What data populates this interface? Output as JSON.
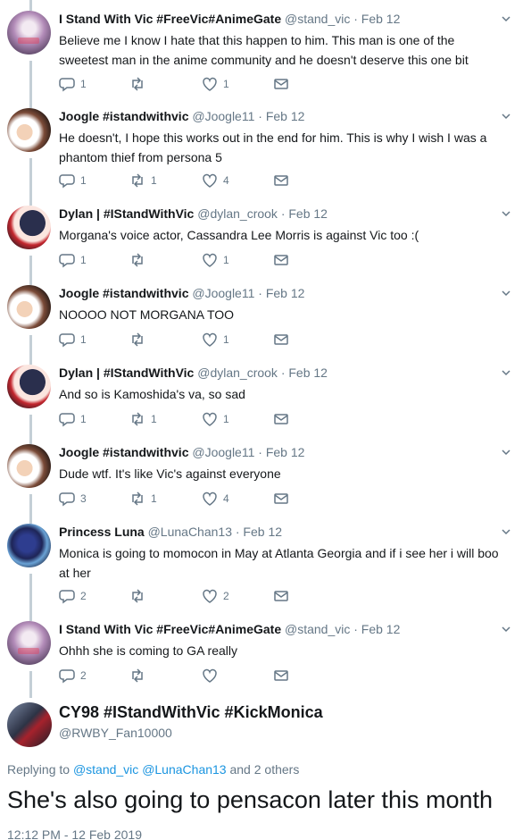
{
  "replies": [
    {
      "avatar": "ivic",
      "name": "I Stand With Vic #FreeVic#AnimeGate",
      "handle_meta": "@stand_vic · Feb 12",
      "text": "Believe me I know I hate that this happen to him. This man is one of the sweetest man in the anime community and he doesn't deserve this one bit",
      "replies": "1",
      "retweets": "",
      "likes": "1"
    },
    {
      "avatar": "joogle",
      "name": "Joogle #istandwithvic",
      "handle_meta": "@Joogle11 · Feb 12",
      "text": "He doesn't, I hope this works out in the end for him. This is why I wish I was a phantom thief from persona 5",
      "replies": "1",
      "retweets": "1",
      "likes": "4"
    },
    {
      "avatar": "dylan",
      "name": "Dylan | #IStandWithVic",
      "handle_meta": "@dylan_crook · Feb 12",
      "text": "Morgana's voice actor, Cassandra Lee Morris is against Vic too :(",
      "replies": "1",
      "retweets": "",
      "likes": "1"
    },
    {
      "avatar": "joogle",
      "name": "Joogle #istandwithvic",
      "handle_meta": "@Joogle11 · Feb 12",
      "text": "NOOOO NOT MORGANA TOO",
      "replies": "1",
      "retweets": "",
      "likes": "1"
    },
    {
      "avatar": "dylan",
      "name": "Dylan | #IStandWithVic",
      "handle_meta": "@dylan_crook · Feb 12",
      "text": "And so is Kamoshida's va, so sad",
      "replies": "1",
      "retweets": "1",
      "likes": "1"
    },
    {
      "avatar": "joogle",
      "name": "Joogle #istandwithvic",
      "handle_meta": "@Joogle11 · Feb 12",
      "text": "Dude wtf. It's like Vic's against everyone",
      "replies": "3",
      "retweets": "1",
      "likes": "4"
    },
    {
      "avatar": "luna",
      "name": "Princess Luna",
      "handle_meta": "@LunaChan13 · Feb 12",
      "text": "Monica is going to momocon in May at Atlanta Georgia and if i see her i will boo at her",
      "replies": "2",
      "retweets": "",
      "likes": "2"
    },
    {
      "avatar": "ivic",
      "name": "I Stand With Vic #FreeVic#AnimeGate",
      "handle_meta": "@stand_vic · Feb 12",
      "text": "Ohhh she is coming to GA really",
      "replies": "2",
      "retweets": "",
      "likes": ""
    }
  ],
  "main": {
    "name": "CY98 #IStandWithVic #KickMonica",
    "handle": "@RWBY_Fan10000",
    "replying_prefix": "Replying to",
    "replying_user1": "@stand_vic",
    "replying_user2": "@LunaChan13",
    "replying_suffix": "and 2 others",
    "text": "She's also going to pensacon later this month",
    "timestamp": "12:12 PM - 12 Feb 2019"
  },
  "colors": {
    "accent": "#1b95e0",
    "muted": "#657786",
    "thread": "#c4cfd6"
  }
}
